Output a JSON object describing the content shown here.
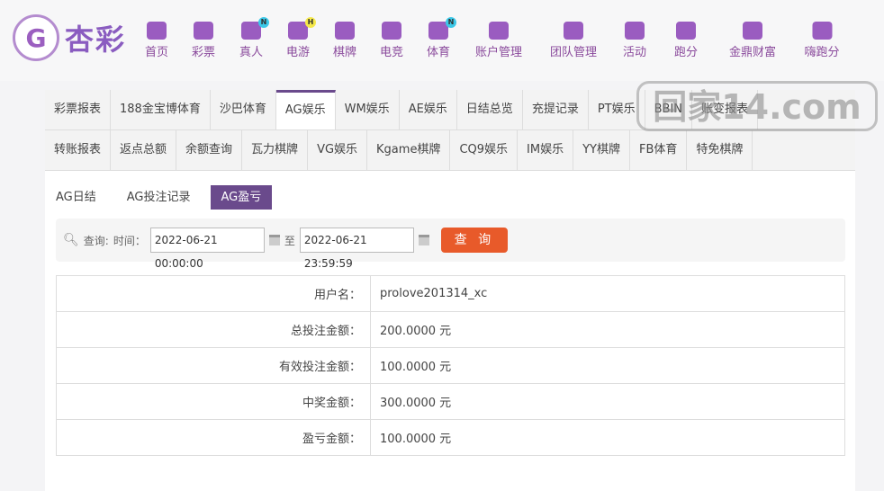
{
  "logo": {
    "text": "杏彩"
  },
  "nav": [
    {
      "label": "首页",
      "icon": "home-icon"
    },
    {
      "label": "彩票",
      "icon": "ticket-icon"
    },
    {
      "label": "真人",
      "icon": "person-icon",
      "badge": "N",
      "badge_color": "#3cc8e8"
    },
    {
      "label": "电游",
      "icon": "gamepad-icon",
      "badge": "H",
      "badge_color": "#f5e84a"
    },
    {
      "label": "棋牌",
      "icon": "cards-icon"
    },
    {
      "label": "电竞",
      "icon": "gamepad-icon"
    },
    {
      "label": "体育",
      "icon": "trophy-icon",
      "badge": "N",
      "badge_color": "#3cc8e8"
    },
    {
      "label": "账户管理",
      "icon": "yen-icon"
    },
    {
      "label": "团队管理",
      "icon": "team-icon"
    },
    {
      "label": "活动",
      "icon": "gift-icon"
    },
    {
      "label": "跑分",
      "icon": "rhino-icon"
    },
    {
      "label": "金鼎财富",
      "icon": "treasure-icon"
    },
    {
      "label": "嗨跑分",
      "icon": "hi-icon"
    }
  ],
  "tabs_row1": [
    "彩票报表",
    "188金宝博体育",
    "沙巴体育",
    "AG娱乐",
    "WM娱乐",
    "AE娱乐",
    "日结总览",
    "充提记录",
    "PT娱乐",
    "BBIN",
    "账变报表"
  ],
  "tabs_row2": [
    "转账报表",
    "返点总额",
    "余额查询",
    "瓦力棋牌",
    "VG娱乐",
    "Kgame棋牌",
    "CQ9娱乐",
    "IM娱乐",
    "YY棋牌",
    "FB体育",
    "特免棋牌"
  ],
  "active_tab": "AG娱乐",
  "subtabs": [
    "AG日结",
    "AG投注记录",
    "AG盈亏"
  ],
  "active_subtab": "AG盈亏",
  "query": {
    "label": "查询:",
    "time_label": "时间：",
    "start": "2022-06-21 00:00:00",
    "to": "至",
    "end": "2022-06-21 23:59:59",
    "button": "查 询"
  },
  "rows": [
    {
      "label": "用户名：",
      "value": "prolove201314_xc"
    },
    {
      "label": "总投注金额：",
      "value": "200.0000 元"
    },
    {
      "label": "有效投注金额：",
      "value": "100.0000 元"
    },
    {
      "label": "中奖金额：",
      "value": "300.0000 元"
    },
    {
      "label": "盈亏金额：",
      "value": "100.0000 元"
    }
  ],
  "watermark": "回家14.com",
  "colors": {
    "accent": "#6a4a8c",
    "button": "#e85a2a",
    "nav": "#8a4a9c"
  }
}
